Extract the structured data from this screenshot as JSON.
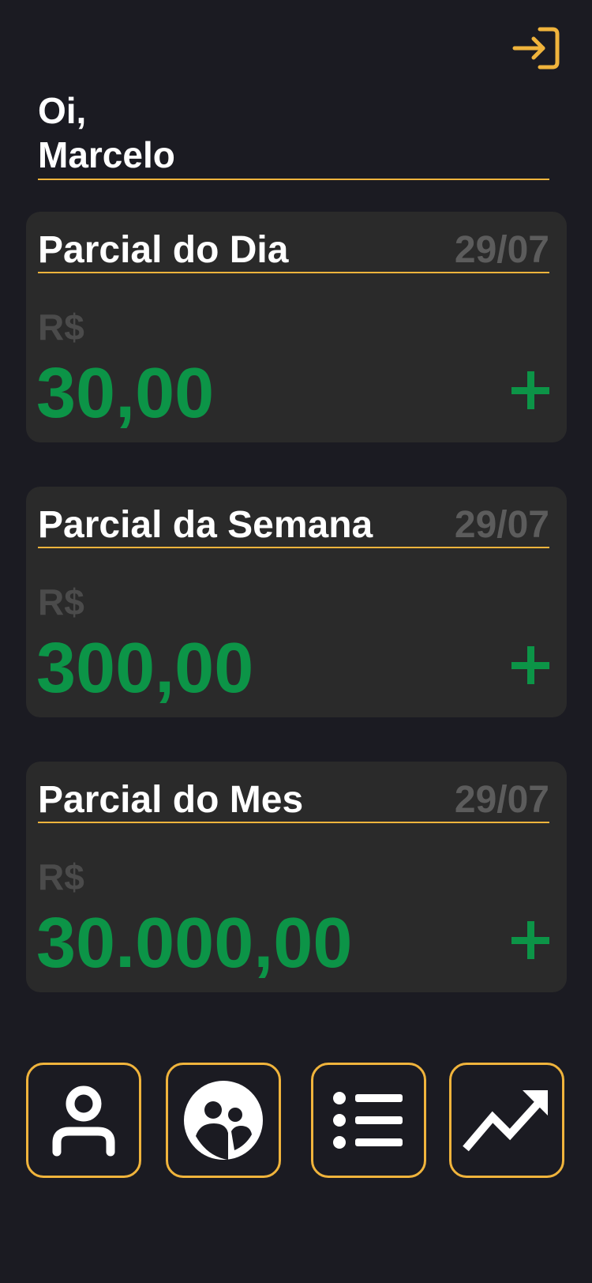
{
  "header": {
    "greeting": "Oi,",
    "user_name": "Marcelo",
    "login_icon": "login-icon"
  },
  "cards": [
    {
      "title": "Parcial do Dia",
      "date": "29/07",
      "currency": "R$",
      "amount": "30,00",
      "add_label": "+"
    },
    {
      "title": "Parcial da Semana",
      "date": "29/07",
      "currency": "R$",
      "amount": "300,00",
      "add_label": "+"
    },
    {
      "title": "Parcial do Mes",
      "date": "29/07",
      "currency": "R$",
      "amount": "30.000,00",
      "add_label": "+"
    }
  ],
  "bottom_nav": [
    {
      "icon": "profile-icon"
    },
    {
      "icon": "users-icon"
    },
    {
      "icon": "list-icon"
    },
    {
      "icon": "trending-up-icon"
    }
  ],
  "colors": {
    "background": "#1b1b22",
    "card": "#2a2a2a",
    "accent": "#f0b43c",
    "amount": "#0c9447",
    "muted": "#5c5c5c"
  }
}
